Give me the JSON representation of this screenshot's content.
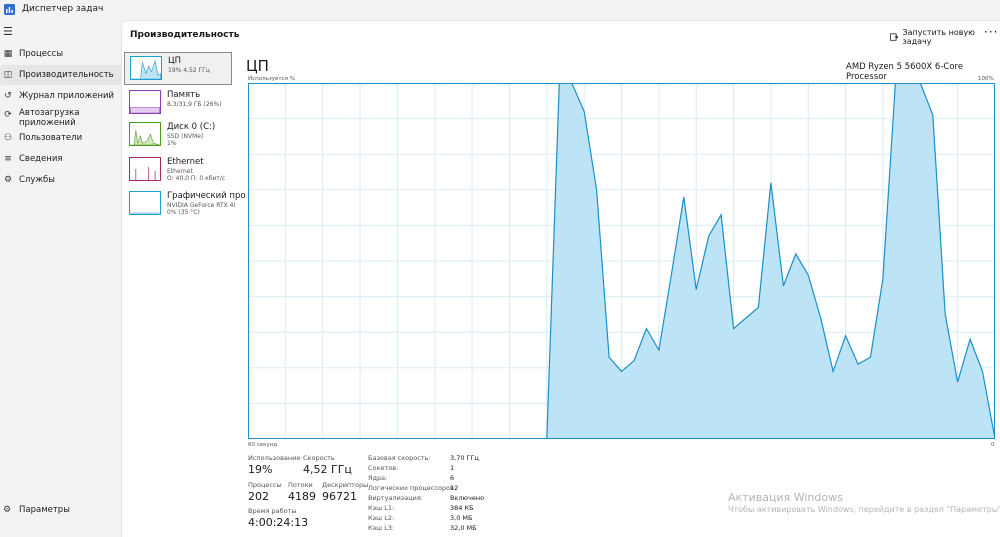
{
  "window": {
    "title": "Диспетчер задач"
  },
  "nav": {
    "items": [
      {
        "label": "Процессы",
        "icon": "grid-icon"
      },
      {
        "label": "Производительность",
        "icon": "performance-icon"
      },
      {
        "label": "Журнал приложений",
        "icon": "history-icon"
      },
      {
        "label": "Автозагрузка\nприложений",
        "line1": "Автозагрузка",
        "line2": "приложений",
        "icon": "startup-icon"
      },
      {
        "label": "Пользователи",
        "icon": "users-icon"
      },
      {
        "label": "Сведения",
        "icon": "details-icon"
      },
      {
        "label": "Службы",
        "icon": "services-icon"
      }
    ],
    "settings_label": "Параметры"
  },
  "header": {
    "title": "Производительность",
    "run_task_label": "Запустить новую задачу",
    "more_label": "···"
  },
  "devices": [
    {
      "name": "ЦП",
      "sub1": "19% 4,52 ГГц",
      "sub2": "",
      "color": "#1a9ed5"
    },
    {
      "name": "Память",
      "sub1": "8,3/31,9 ГБ (26%)",
      "sub2": "",
      "color": "#8b3dbd"
    },
    {
      "name": "Диск 0 (C:)",
      "sub1": "SSD (NVMe)",
      "sub2": "1%",
      "color": "#4d9a19"
    },
    {
      "name": "Ethernet",
      "sub1": "Ethernet",
      "sub2": "О: 40,0 П: 0 кбит/с",
      "color": "#a4275f"
    },
    {
      "name": "Графический про",
      "sub1": "NVIDIA GeForce RTX 40(",
      "sub2": "0% (35 °C)",
      "color": "#1a9ed5"
    }
  ],
  "cpu": {
    "title": "ЦП",
    "model": "AMD Ryzen 5 5600X 6-Core Processor",
    "usage_axis_label": "Используется %",
    "max_label": "100%",
    "x_left_label": "60 секунд",
    "x_right_label": "0",
    "stats": {
      "usage_label": "Использование",
      "usage_value": "19%",
      "speed_label": "Скорость",
      "speed_value": "4,52 ГГц",
      "processes_label": "Процессы",
      "processes_value": "202",
      "threads_label": "Потоки",
      "threads_value": "4189",
      "handles_label": "Дескрипторы",
      "handles_value": "96721",
      "uptime_label": "Время работы",
      "uptime_value": "4:00:24:13"
    },
    "specs": [
      {
        "label": "Базовая скорость:",
        "value": "3,70 ГГц"
      },
      {
        "label": "Сокетов:",
        "value": "1"
      },
      {
        "label": "Ядра:",
        "value": "6"
      },
      {
        "label": "Логических процессоров:",
        "value": "12"
      },
      {
        "label": "Виртуализация:",
        "value": "Включено"
      },
      {
        "label": "Кэш L1:",
        "value": "384 КБ"
      },
      {
        "label": "Кэш L2:",
        "value": "3,0 МБ"
      },
      {
        "label": "Кэш L3:",
        "value": "32,0 МБ"
      }
    ]
  },
  "chart_data": {
    "type": "area",
    "x": [
      60,
      59,
      58,
      57,
      56,
      55,
      54,
      53,
      52,
      51,
      50,
      49,
      48,
      47,
      46,
      45,
      44,
      43,
      42,
      41,
      40,
      39,
      38,
      37,
      36,
      35,
      34,
      33,
      32,
      31,
      30,
      29,
      28,
      27,
      26,
      25,
      24,
      23,
      22,
      21,
      20,
      19,
      18,
      17,
      16,
      15,
      14,
      13,
      12,
      11,
      10,
      9,
      8,
      7,
      6,
      5,
      4,
      3,
      2,
      1,
      0
    ],
    "values": [
      0,
      0,
      0,
      0,
      0,
      0,
      0,
      0,
      0,
      0,
      0,
      0,
      0,
      0,
      0,
      0,
      0,
      0,
      0,
      0,
      0,
      0,
      0,
      0,
      0,
      100,
      100,
      92,
      70,
      23,
      19,
      22,
      31,
      25,
      46,
      68,
      42,
      57,
      63,
      31,
      34,
      37,
      72,
      43,
      52,
      46,
      34,
      19,
      29,
      21,
      23,
      45,
      100,
      100,
      100,
      91,
      35,
      16,
      28,
      19,
      0
    ],
    "ylim": [
      0,
      100
    ],
    "grid": true,
    "line_color": "#1a8fc9",
    "fill_color": "#bde4f6"
  },
  "watermark": {
    "title": "Активация Windows",
    "subtitle": "Чтобы активировать Windows, перейдите в раздел \"Параметры\"."
  }
}
